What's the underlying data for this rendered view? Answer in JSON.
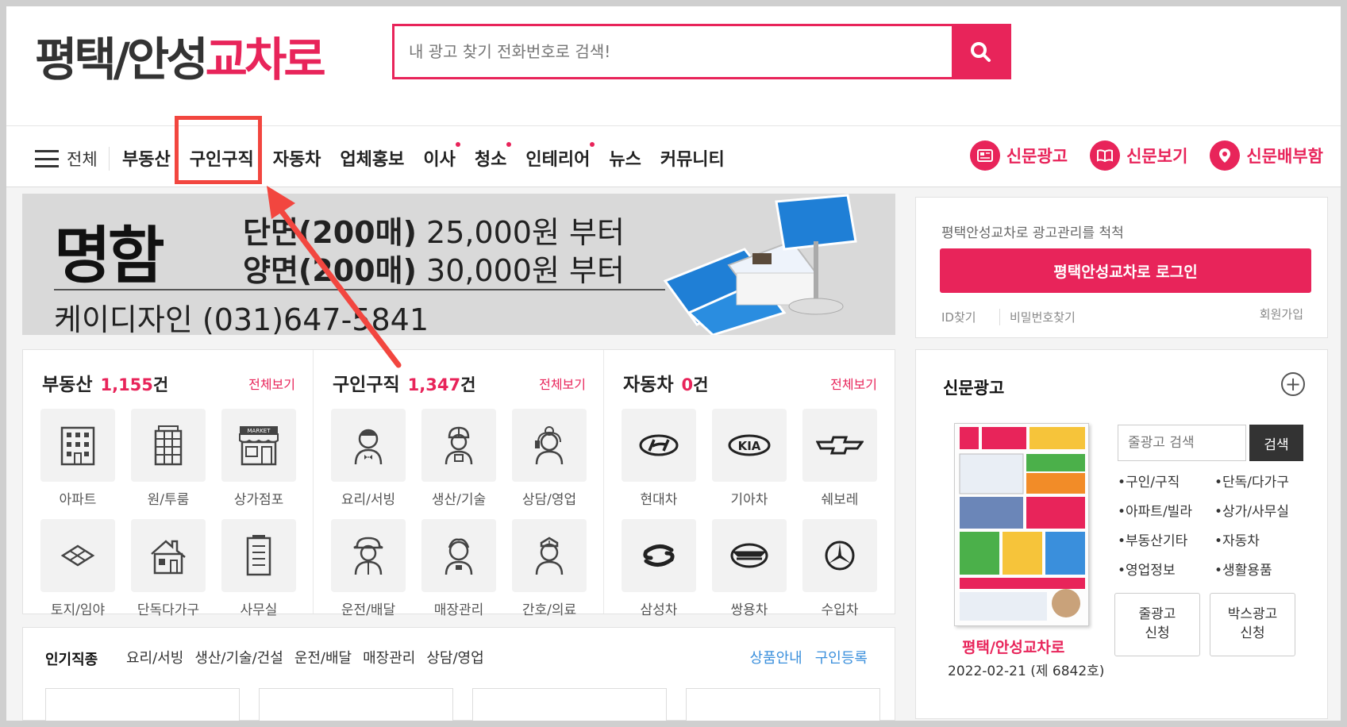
{
  "header": {
    "logo_part1": "평택/안성",
    "logo_part2": "교차로",
    "search_placeholder": "내 광고 찾기 전화번호로 검색!"
  },
  "nav": {
    "all_label": "전체",
    "items": [
      {
        "label": "부동산",
        "dot": false
      },
      {
        "label": "구인구직",
        "dot": false
      },
      {
        "label": "자동차",
        "dot": false
      },
      {
        "label": "업체홍보",
        "dot": false
      },
      {
        "label": "이사",
        "dot": true
      },
      {
        "label": "청소",
        "dot": true
      },
      {
        "label": "인테리어",
        "dot": true
      },
      {
        "label": "뉴스",
        "dot": false
      },
      {
        "label": "커뮤니티",
        "dot": false
      }
    ],
    "right_links": [
      "신문광고",
      "신문보기",
      "신문배부함"
    ]
  },
  "banner": {
    "title": "명함",
    "line1_bold": "단면(200매)",
    "line1_rest": " 25,000원 부터",
    "line2_bold": "양면(200매)",
    "line2_rest": " 30,000원 부터",
    "contact": "케이디자인 (031)647-5841"
  },
  "login": {
    "tagline": "평택안성교차로 광고관리를 척척",
    "button": "평택안성교차로 로그인",
    "find_id": "ID찾기",
    "find_pw": "비밀번호찾기",
    "signup": "회원가입"
  },
  "categories": [
    {
      "title": "부동산",
      "count": "1,155",
      "unit": "건",
      "more": "전체보기",
      "tiles": [
        {
          "label": "아파트",
          "icon": "apartment-icon"
        },
        {
          "label": "원/투룸",
          "icon": "building-icon"
        },
        {
          "label": "상가점포",
          "icon": "market-icon"
        },
        {
          "label": "토지/임야",
          "icon": "land-icon"
        },
        {
          "label": "단독다가구",
          "icon": "house-icon"
        },
        {
          "label": "사무실",
          "icon": "office-icon"
        }
      ]
    },
    {
      "title": "구인구직",
      "count": "1,347",
      "unit": "건",
      "more": "전체보기",
      "tiles": [
        {
          "label": "요리/서빙",
          "icon": "waiter-icon"
        },
        {
          "label": "생산/기술",
          "icon": "worker-icon"
        },
        {
          "label": "상담/영업",
          "icon": "consultant-icon"
        },
        {
          "label": "운전/배달",
          "icon": "driver-icon"
        },
        {
          "label": "매장관리",
          "icon": "store-manager-icon"
        },
        {
          "label": "간호/의료",
          "icon": "nurse-icon"
        }
      ]
    },
    {
      "title": "자동차",
      "count": "0",
      "unit": "건",
      "more": "전체보기",
      "tiles": [
        {
          "label": "현대차",
          "icon": "hyundai-logo-icon"
        },
        {
          "label": "기아차",
          "icon": "kia-logo-icon"
        },
        {
          "label": "쉐보레",
          "icon": "chevrolet-logo-icon"
        },
        {
          "label": "삼성차",
          "icon": "samsung-logo-icon"
        },
        {
          "label": "쌍용차",
          "icon": "ssangyong-logo-icon"
        },
        {
          "label": "수입차",
          "icon": "mercedes-logo-icon"
        }
      ]
    }
  ],
  "popular": {
    "heading": "인기직종",
    "tags": [
      "요리/서빙",
      "생산/기술/건설",
      "운전/배달",
      "매장관리",
      "상담/영업"
    ],
    "actions": [
      "상품안내",
      "구인등록"
    ]
  },
  "newspaper": {
    "heading": "신문광고",
    "paper_name": "평택/안성교차로",
    "paper_date": "2022-02-21 (제 6842호)",
    "search_placeholder": "줄광고 검색",
    "search_button": "검색",
    "links": [
      "•구인/구직",
      "•단독/다가구",
      "•아파트/빌라",
      "•상가/사무실",
      "•부동산기타",
      "•자동차",
      "•영업정보",
      "•생활용품"
    ],
    "apply_line_1": "줄광고",
    "apply_line_2": "신청",
    "apply_box_1": "박스광고",
    "apply_box_2": "신청"
  },
  "colors": {
    "accent": "#e8245a",
    "highlight": "#f2463f",
    "link_blue": "#3a8fdc"
  }
}
